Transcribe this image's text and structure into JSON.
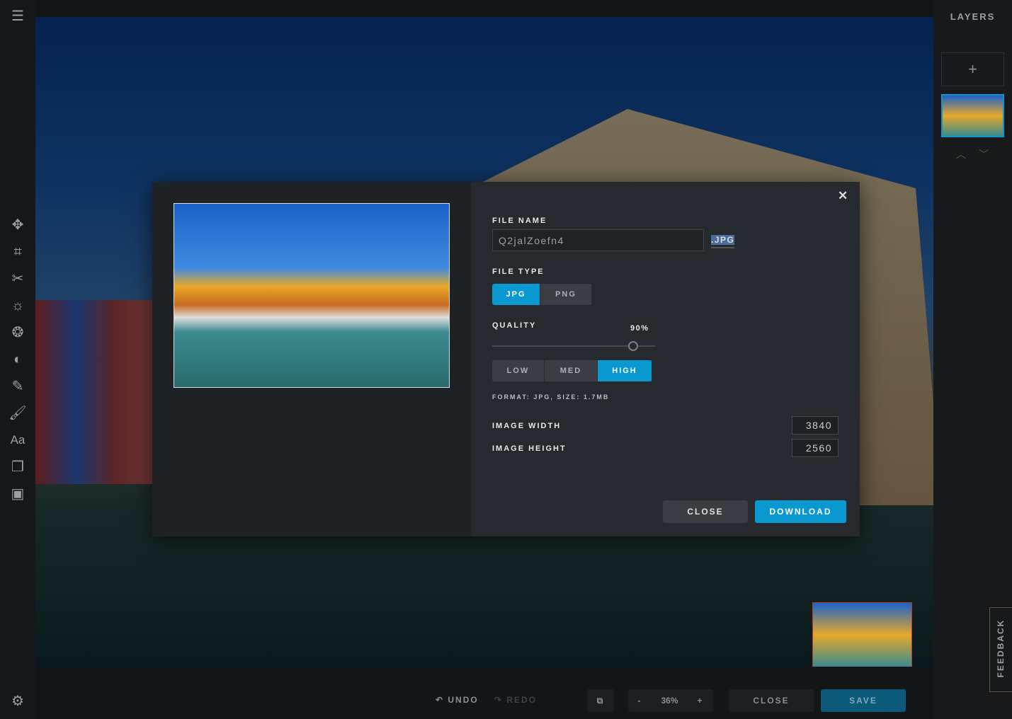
{
  "layers_panel": {
    "title": "LAYERS",
    "add_icon": "plus-icon"
  },
  "modal": {
    "file_name_label": "FILE NAME",
    "file_name_value": "Q2jalZoefn4",
    "extension": ".JPG",
    "file_type_label": "FILE TYPE",
    "file_types": [
      "JPG",
      "PNG"
    ],
    "selected_type": "JPG",
    "quality_label": "QUALITY",
    "quality_value": "90%",
    "quality_percent": 90,
    "presets": [
      "LOW",
      "MED",
      "HIGH"
    ],
    "selected_preset": "HIGH",
    "format_info": "FORMAT: JPG, SIZE: 1.7MB",
    "width_label": "IMAGE WIDTH",
    "width_value": "3840",
    "height_label": "IMAGE HEIGHT",
    "height_value": "2560",
    "close_label": "CLOSE",
    "download_label": "DOWNLOAD",
    "close_icon": "✕"
  },
  "bottom": {
    "undo": "UNDO",
    "redo": "REDO",
    "zoom_minus": "-",
    "zoom": "36%",
    "zoom_plus": "+",
    "close": "CLOSE",
    "save": "SAVE"
  },
  "feedback": "FEEDBACK",
  "colors": {
    "accent": "#0a98d0",
    "modal_bg": "#262a2e"
  }
}
